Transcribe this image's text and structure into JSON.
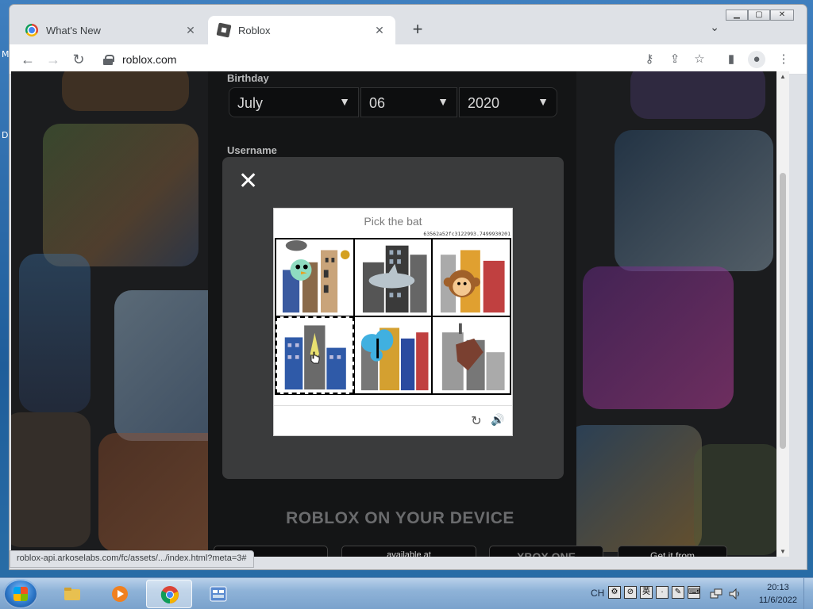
{
  "window": {
    "tabs": [
      {
        "label": "What's New",
        "close": "✕"
      },
      {
        "label": "Roblox",
        "close": "✕"
      }
    ],
    "new_tab": "+",
    "tab_list": "⌄",
    "controls": {
      "min": "▁",
      "max": "▢",
      "close": "✕"
    }
  },
  "toolbar": {
    "back": "←",
    "forward": "→",
    "reload": "↻",
    "url": "roblox.com",
    "icons": [
      "key-icon",
      "share-icon",
      "star-icon",
      "side-panel-icon",
      "profile-icon",
      "menu-icon"
    ],
    "glyphs": {
      "key": "⚷",
      "share": "⇪",
      "star": "☆",
      "side": "▮",
      "profile": "●",
      "menu": "⋮"
    }
  },
  "page": {
    "birthday_label": "Birthday",
    "month": "July",
    "day": "06",
    "year": "2020",
    "username_label": "Username",
    "device_heading": "ROBLOX ON YOUR DEVICE",
    "stores": [
      "",
      "available at",
      "XBOX ONE",
      "Get it from"
    ]
  },
  "captcha": {
    "close": "✕",
    "prompt": "Pick the bat",
    "session_id": "63562a52fc3122993.7499930201",
    "tiles": [
      "bird-on-buildings",
      "shark-on-skyscraper",
      "monkey-on-buildings",
      "bat-on-building",
      "butterfly-on-buildings",
      "broken-building"
    ],
    "refresh": "↻",
    "audio": "🔊"
  },
  "status_bubble": "roblox-api.arkoselabs.com/fc/assets/.../index.html?meta=3#",
  "taskbar": {
    "lang": "CH",
    "tray": [
      "⚙",
      "⊘",
      "英",
      "·",
      "✎",
      "⌨"
    ],
    "time": "20:13",
    "date": "11/6/2022"
  },
  "colors": {
    "modal": "#3a3b3c",
    "page_bg": "#1b1c1e",
    "tab_bg": "#dee1e6"
  }
}
